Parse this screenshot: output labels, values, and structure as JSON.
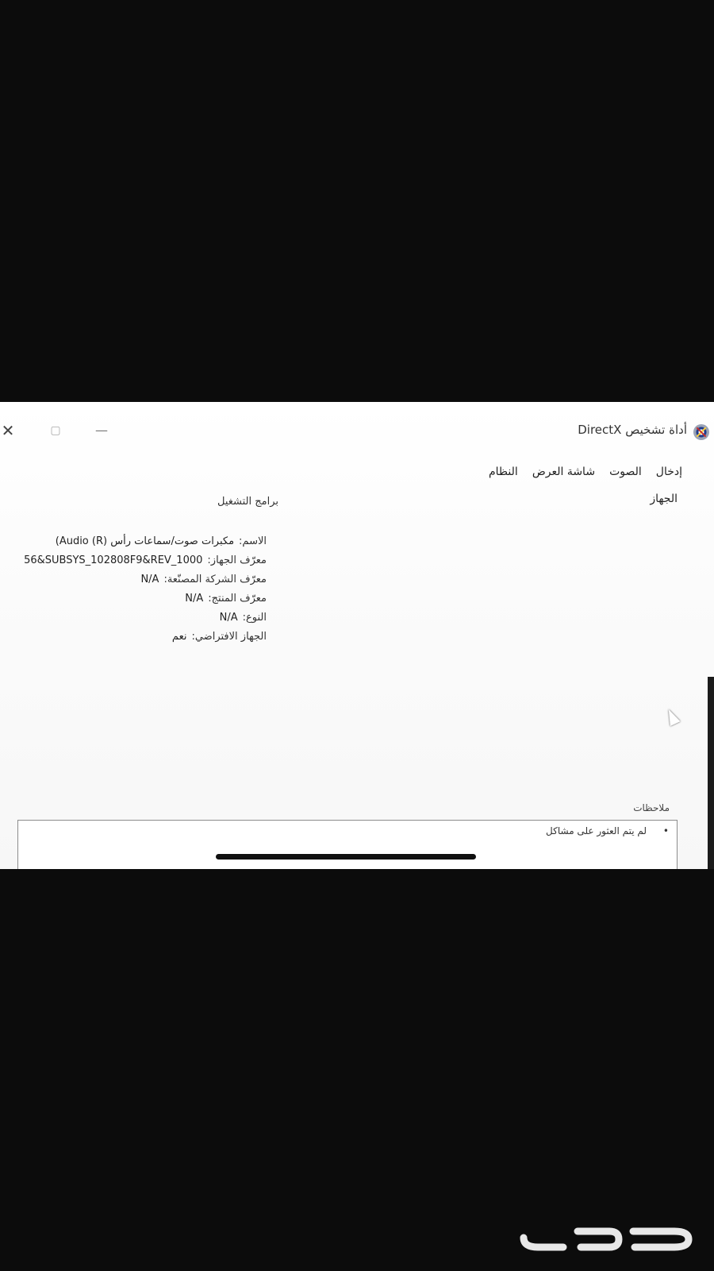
{
  "window": {
    "title": "أداة تشخيص DirectX",
    "close_glyph": "✕",
    "maximize_glyph": "▢",
    "minimize_glyph": "—"
  },
  "tabs": [
    "النظام",
    "شاشة العرض",
    "الصوت",
    "إدخال"
  ],
  "sections": {
    "device": "الجهاز",
    "drivers": "برامج التشغيل"
  },
  "device_info": [
    {
      "label": "الاسم:",
      "value": "مكبرات صوت/سماعات رأس (R) Audio)"
    },
    {
      "label": "معرّف الجهاز:",
      "value": "56&SUBSYS_102808F9&REV_1000"
    },
    {
      "label": "معرّف الشركة المصنّعة:",
      "value": "N/A"
    },
    {
      "label": "معرّف المنتج:",
      "value": "N/A"
    },
    {
      "label": "النوع:",
      "value": "N/A"
    },
    {
      "label": "الجهاز الافتراضي:",
      "value": "نعم"
    }
  ],
  "notes": {
    "label": "ملاحظات",
    "items": [
      "لم يتم العثور على مشاكل"
    ]
  },
  "colors": {
    "background": "#0c0c0c",
    "window_bg": "#ffffff",
    "text": "#222222"
  },
  "icons": [
    "directx-icon",
    "close-icon",
    "maximize-icon",
    "minimize-icon",
    "cursor-icon",
    "haraj-watermark-logo"
  ],
  "watermark": {
    "text": "حراج"
  }
}
